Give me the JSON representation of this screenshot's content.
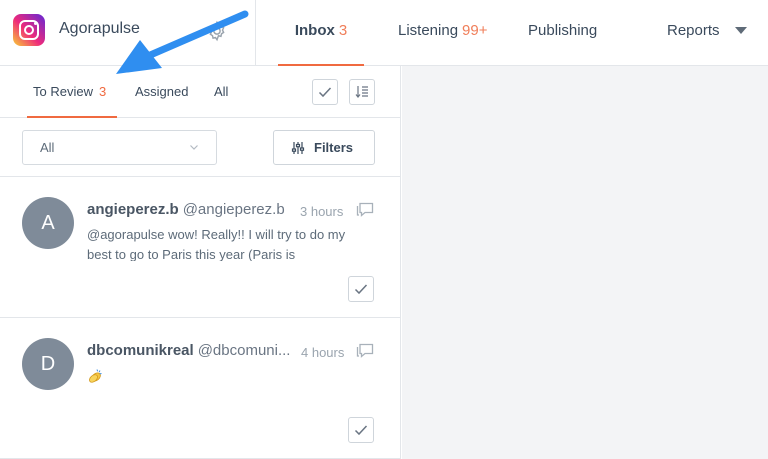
{
  "brand": {
    "name": "Agorapulse",
    "logo_icon": "instagram-logo-icon",
    "settings_icon": "gear-icon"
  },
  "nav": [
    {
      "label": "Inbox",
      "count": "3",
      "active": true
    },
    {
      "label": "Listening",
      "count": "99+"
    },
    {
      "label": "Publishing"
    },
    {
      "label": "Reports",
      "menu_icon": "caret-down-icon"
    }
  ],
  "subtabs": [
    {
      "label": "To Review",
      "count": "3",
      "active": true
    },
    {
      "label": "Assigned"
    },
    {
      "label": "All"
    }
  ],
  "filter": {
    "select_value": "All",
    "filters_label": "Filters"
  },
  "items": [
    {
      "avatar_letter": "A",
      "name": "angieperez.b",
      "handle": "@angieperez.b",
      "time": "3 hours",
      "message": "@agorapulse wow! Really!! I will try to do my best to go to Paris this year (Paris is"
    },
    {
      "avatar_letter": "D",
      "name": "dbcomunikreal",
      "handle": "@dbcomuni...",
      "time": "4 hours",
      "emoji_icon": "clapping-hands-icon"
    }
  ],
  "colors": {
    "accent": "#f06a40",
    "annotation_arrow": "#2f8ef0",
    "avatar": "#7f8b99"
  }
}
